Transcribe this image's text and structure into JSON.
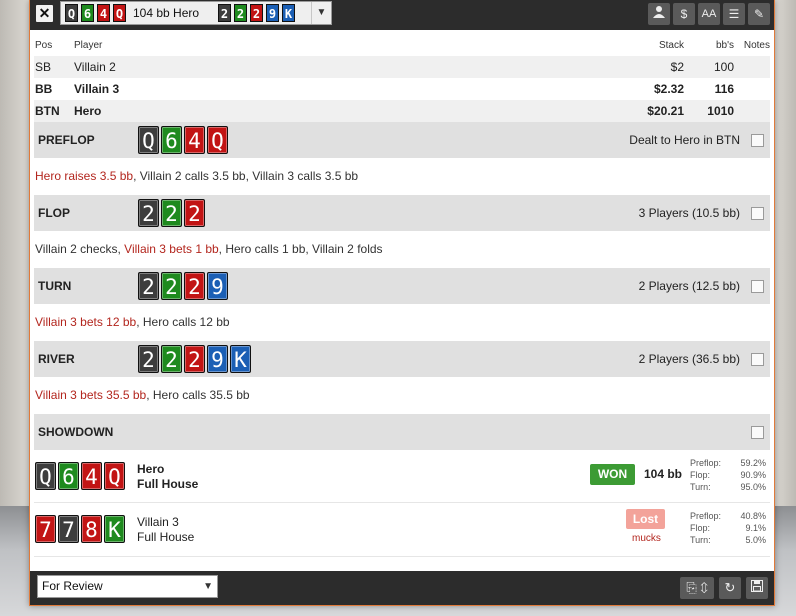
{
  "titlebar": {
    "close_label": "✕",
    "hand_cards": [
      "Q",
      "6",
      "4",
      "Q"
    ],
    "hand_card_colors": [
      "black",
      "green",
      "red",
      "red"
    ],
    "hand_label": "104 bb Hero",
    "board_cards": [
      "2",
      "2",
      "2",
      "9",
      "K"
    ],
    "board_card_colors": [
      "black",
      "green",
      "red",
      "blue",
      "blue"
    ],
    "icons": [
      "user-icon",
      "dollar-icon",
      "font-size-icon",
      "list-icon",
      "pencil-icon"
    ]
  },
  "players": {
    "headers": {
      "pos": "Pos",
      "player": "Player",
      "stack": "Stack",
      "bbs": "bb's",
      "notes": "Notes"
    },
    "rows": [
      {
        "pos": "SB",
        "player": "Villain 2",
        "stack": "$2",
        "bbs": "100"
      },
      {
        "pos": "BB",
        "player": "Villain 3",
        "stack": "$2.32",
        "bbs": "116"
      },
      {
        "pos": "BTN",
        "player": "Hero",
        "stack": "$20.21",
        "bbs": "1010"
      }
    ]
  },
  "streets": {
    "preflop": {
      "name": "PREFLOP",
      "info": "Dealt to Hero in BTN",
      "actions": [
        {
          "text": "Hero raises 3.5 bb",
          "red": true
        },
        {
          "text": ", Villain 2 calls 3.5 bb, Villain 3 calls 3.5 bb",
          "red": false
        }
      ]
    },
    "flop": {
      "name": "FLOP",
      "info": "3 Players (10.5 bb)",
      "actions": [
        {
          "text": "Villain 2 checks, ",
          "red": false
        },
        {
          "text": "Villain 3 bets 1 bb",
          "red": true
        },
        {
          "text": ", Hero calls 1 bb, Villain 2 folds",
          "red": false
        }
      ]
    },
    "turn": {
      "name": "TURN",
      "info": "2 Players (12.5 bb)",
      "actions": [
        {
          "text": "Villain 3 bets 12 bb",
          "red": true
        },
        {
          "text": ", Hero calls 12 bb",
          "red": false
        }
      ]
    },
    "river": {
      "name": "RIVER",
      "info": "2 Players (36.5 bb)",
      "actions": [
        {
          "text": "Villain 3 bets 35.5 bb",
          "red": true
        },
        {
          "text": ", Hero calls 35.5 bb",
          "red": false
        }
      ]
    },
    "showdown": {
      "name": "SHOWDOWN"
    }
  },
  "showdown": {
    "hero": {
      "name": "Hero",
      "hand": "Full House",
      "result": "WON",
      "amount": "104 bb",
      "equity": [
        {
          "label": "Preflop:",
          "value": "59.2%"
        },
        {
          "label": "Flop:",
          "value": "90.9%"
        },
        {
          "label": "Turn:",
          "value": "95.0%"
        }
      ]
    },
    "villain": {
      "name": "Villain 3",
      "hand": "Full House",
      "result": "Lost",
      "sub": "mucks",
      "equity": [
        {
          "label": "Preflop:",
          "value": "40.8%"
        },
        {
          "label": "Flop:",
          "value": "9.1%"
        },
        {
          "label": "Turn:",
          "value": "5.0%"
        }
      ]
    }
  },
  "bottombar": {
    "review_value": "For Review",
    "icons": [
      "copy-icon",
      "refresh-icon",
      "save-icon"
    ]
  },
  "colors": {
    "accent_border": "#e07a3a",
    "won": "#3c9b34",
    "lost": "#f3a39a",
    "action_red": "#b3261e"
  }
}
